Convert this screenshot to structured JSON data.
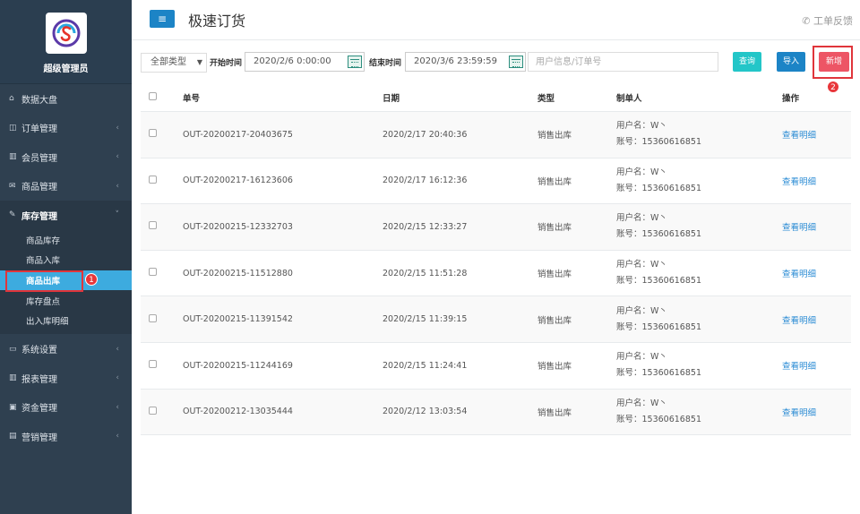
{
  "sidebar": {
    "user_name": "超级管理员",
    "items": [
      {
        "label": "数据大盘",
        "icon": "home-icon",
        "glyph": "⌂"
      },
      {
        "label": "订单管理",
        "icon": "list-icon",
        "glyph": "◫"
      },
      {
        "label": "会员管理",
        "icon": "bar-chart-icon",
        "glyph": "▥"
      },
      {
        "label": "商品管理",
        "icon": "envelope-icon",
        "glyph": "✉"
      },
      {
        "label": "库存管理",
        "icon": "edit-icon",
        "glyph": "✎"
      },
      {
        "label": "系统设置",
        "icon": "monitor-icon",
        "glyph": "▭"
      },
      {
        "label": "报表管理",
        "icon": "bar-chart-icon",
        "glyph": "▥"
      },
      {
        "label": "资金管理",
        "icon": "money-icon",
        "glyph": "▣"
      },
      {
        "label": "营销管理",
        "icon": "gift-icon",
        "glyph": "▤"
      }
    ],
    "sub_items": [
      "商品库存",
      "商品入库",
      "商品出库",
      "库存盘点",
      "出入库明细"
    ],
    "chevron_closed": "‹",
    "chevron_open": "˅"
  },
  "header": {
    "menu_icon": "≡",
    "title": "极速订货",
    "feedback_icon": "✆",
    "feedback_label": "工单反馈"
  },
  "toolbar": {
    "type_select": "全部类型",
    "start_label": "开始时间",
    "start_value": "2020/2/6 0:00:00",
    "end_label": "结束时间",
    "end_value": "2020/3/6 23:59:59",
    "search_placeholder": "用户信息/订单号",
    "query_label": "查询",
    "import_label": "导入",
    "add_label": "新增",
    "query_color": "#23c6c8",
    "import_color": "#1c84c6",
    "add_color": "#ed5565"
  },
  "annotations": {
    "badge1": "1",
    "badge2": "2"
  },
  "table": {
    "headers": [
      "单号",
      "日期",
      "类型",
      "制单人",
      "操作"
    ],
    "rows": [
      {
        "no": "OUT-20200217-20403675",
        "date": "2020/2/17 20:40:36",
        "type": "销售出库",
        "user": "用户名：W丶",
        "account": "账号：15360616851",
        "action": "查看明细"
      },
      {
        "no": "OUT-20200217-16123606",
        "date": "2020/2/17 16:12:36",
        "type": "销售出库",
        "user": "用户名：W丶",
        "account": "账号：15360616851",
        "action": "查看明细"
      },
      {
        "no": "OUT-20200215-12332703",
        "date": "2020/2/15 12:33:27",
        "type": "销售出库",
        "user": "用户名：W丶",
        "account": "账号：15360616851",
        "action": "查看明细"
      },
      {
        "no": "OUT-20200215-11512880",
        "date": "2020/2/15 11:51:28",
        "type": "销售出库",
        "user": "用户名：W丶",
        "account": "账号：15360616851",
        "action": "查看明细"
      },
      {
        "no": "OUT-20200215-11391542",
        "date": "2020/2/15 11:39:15",
        "type": "销售出库",
        "user": "用户名：W丶",
        "account": "账号：15360616851",
        "action": "查看明细"
      },
      {
        "no": "OUT-20200215-11244169",
        "date": "2020/2/15 11:24:41",
        "type": "销售出库",
        "user": "用户名：W丶",
        "account": "账号：15360616851",
        "action": "查看明细"
      },
      {
        "no": "OUT-20200212-13035444",
        "date": "2020/2/12 13:03:54",
        "type": "销售出库",
        "user": "用户名：W丶",
        "account": "账号：15360616851",
        "action": "查看明细"
      }
    ]
  }
}
